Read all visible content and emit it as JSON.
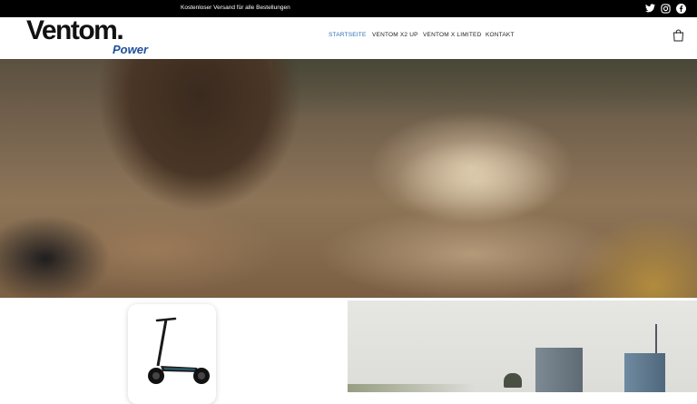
{
  "announcement": {
    "text": "Kostenloser Versand für alle Bestellungen"
  },
  "social": {
    "icons": [
      "twitter-icon",
      "instagram-icon",
      "facebook-icon"
    ]
  },
  "brand": {
    "name": "Ventom.",
    "tagline": "Power",
    "accent_color": "#1f4e9b"
  },
  "nav": {
    "items": [
      {
        "label": "STARTSEITE",
        "active": true
      },
      {
        "label": "VENTOM X2 UP",
        "active": false
      },
      {
        "label": "VENTOM X LIMITED",
        "active": false
      },
      {
        "label": "KONTAKT",
        "active": false
      }
    ],
    "active_color": "#2a6db5"
  },
  "cart": {
    "icon": "shopping-bag-icon"
  }
}
